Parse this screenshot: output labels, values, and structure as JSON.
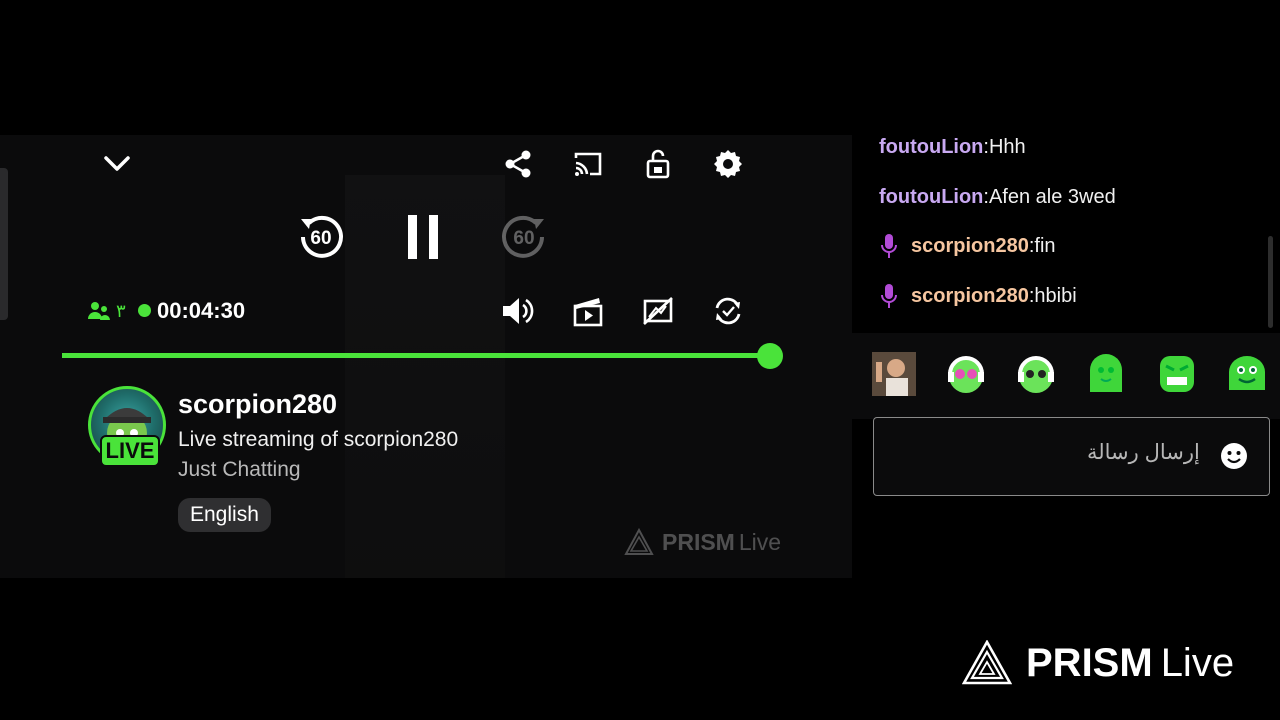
{
  "player": {
    "viewer_count": "٣",
    "elapsed": "00:04:30",
    "progress": 0.999,
    "seek_back_label": "60",
    "seek_forward_label": "60"
  },
  "streamer": {
    "name": "scorpion280",
    "title": "Live streaming of scorpion280",
    "category": "Just Chatting",
    "language": "English",
    "badge": "LIVE"
  },
  "watermark": {
    "brand_bold": "PRISM",
    "brand_light": "Live"
  },
  "chat": {
    "messages": [
      {
        "user": "foutouLion",
        "sep": ":",
        "text": " Hhh",
        "color": "purple",
        "mic": false
      },
      {
        "user": "foutouLion",
        "sep": ":",
        "text": " Afen ale 3wed",
        "color": "purple",
        "mic": false
      },
      {
        "user": "scorpion280",
        "sep": ":",
        "text": " fin",
        "color": "orange",
        "mic": true
      },
      {
        "user": "scorpion280",
        "sep": ":",
        "text": " hbibi",
        "color": "orange",
        "mic": true
      }
    ],
    "input_placeholder": "إرسال رسالة"
  },
  "colors": {
    "accent": "#4ae33a",
    "mic": "#b24bd6"
  },
  "icons": [
    "chevron-down-icon",
    "share-icon",
    "cast-icon",
    "pip-icon",
    "gear-icon",
    "rewind-60-icon",
    "pause-icon",
    "forward-60-icon",
    "viewers-icon",
    "volume-icon",
    "clip-icon",
    "chat-off-icon",
    "sync-icon",
    "mic-icon",
    "smile-icon",
    "prism-logo-icon"
  ]
}
